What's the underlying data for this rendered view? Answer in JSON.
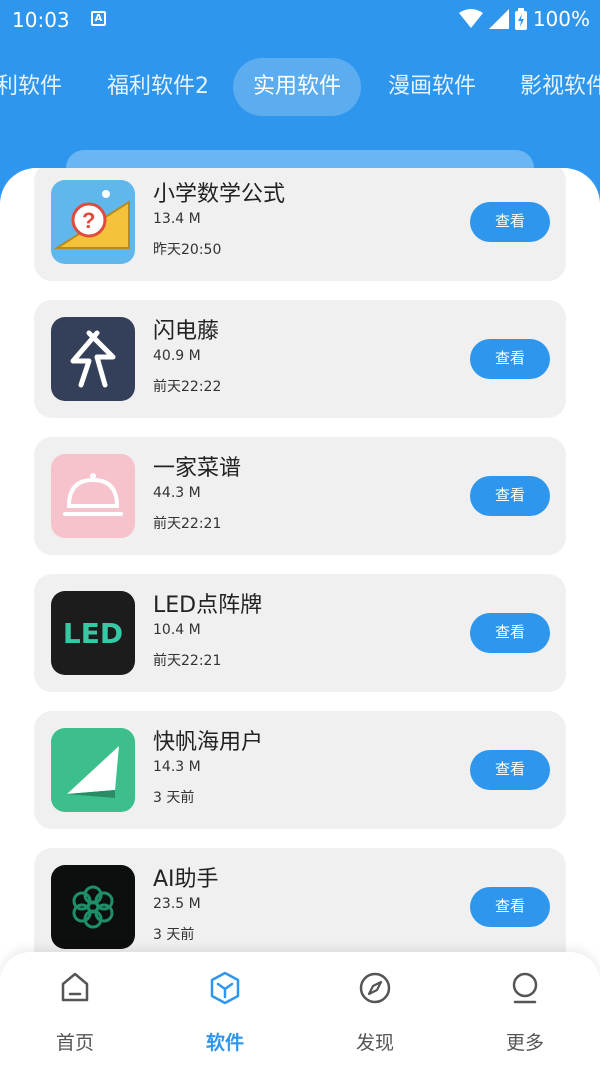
{
  "status_bar": {
    "time": "10:03",
    "notification_glyph": "A",
    "battery": "100%"
  },
  "tabs": [
    {
      "label": "利软件"
    },
    {
      "label": "福利软件2"
    },
    {
      "label": "实用软件",
      "active": true
    },
    {
      "label": "漫画软件"
    },
    {
      "label": "影视软件"
    }
  ],
  "apps": [
    {
      "name": "小学数学公式",
      "size": "13.4 M",
      "date": "昨天20:50",
      "button": "查看",
      "icon": "math-ruler-icon"
    },
    {
      "name": "闪电藤",
      "size": "40.9 M",
      "date": "前天22:22",
      "button": "查看",
      "icon": "lightning-icon"
    },
    {
      "name": "一家菜谱",
      "size": "44.3 M",
      "date": "前天22:21",
      "button": "查看",
      "icon": "food-cover-icon"
    },
    {
      "name": "LED点阵牌",
      "size": "10.4 M",
      "date": "前天22:21",
      "button": "查看",
      "icon": "led-icon",
      "icon_text": "LED"
    },
    {
      "name": "快帆海用户",
      "size": "14.3 M",
      "date": "3 天前",
      "button": "查看",
      "icon": "sail-icon"
    },
    {
      "name": "AI助手",
      "size": "23.5 M",
      "date": "3 天前",
      "button": "查看",
      "icon": "ai-flower-icon"
    }
  ],
  "bottom_nav": [
    {
      "label": "首页",
      "icon": "home-icon"
    },
    {
      "label": "软件",
      "icon": "box-icon",
      "active": true
    },
    {
      "label": "发现",
      "icon": "compass-icon"
    },
    {
      "label": "更多",
      "icon": "user-icon"
    }
  ],
  "colors": {
    "primary": "#2e96ec",
    "card_bg": "#f0f0f0",
    "nav_inactive": "#555555"
  }
}
